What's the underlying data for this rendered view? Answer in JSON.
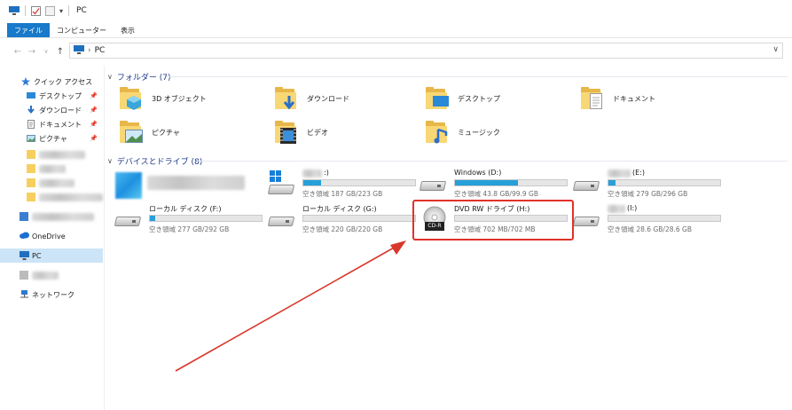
{
  "title": "PC",
  "ribbon": {
    "tabs": [
      "ファイル",
      "コンピューター",
      "表示"
    ]
  },
  "address": {
    "location": "PC"
  },
  "sidebar": {
    "quick_access": "クイック アクセス",
    "items": [
      {
        "label": "デスクトップ",
        "icon": "desktop-icon"
      },
      {
        "label": "ダウンロード",
        "icon": "download-icon"
      },
      {
        "label": "ドキュメント",
        "icon": "document-icon"
      },
      {
        "label": "ピクチャ",
        "icon": "pictures-icon"
      }
    ],
    "onedrive": "OneDrive",
    "pc": "PC",
    "network": "ネットワーク"
  },
  "folders_group": {
    "title": "フォルダー (7)"
  },
  "folders": [
    {
      "label": "3D オブジェクト",
      "icon": "3d-objects-folder-icon"
    },
    {
      "label": "ダウンロード",
      "icon": "downloads-folder-icon"
    },
    {
      "label": "デスクトップ",
      "icon": "desktop-folder-icon"
    },
    {
      "label": "ドキュメント",
      "icon": "documents-folder-icon"
    },
    {
      "label": "ピクチャ",
      "icon": "pictures-folder-icon"
    },
    {
      "label": "ビデオ",
      "icon": "videos-folder-icon"
    },
    {
      "label": "ミュージック",
      "icon": "music-folder-icon"
    }
  ],
  "drives_group": {
    "title": "デバイスとドライブ (8)"
  },
  "drives": [
    {
      "name": "",
      "free": "",
      "used_fraction": 0
    },
    {
      "name": ":)",
      "free": "空き領域 187 GB/223 GB",
      "used_fraction": 0.16
    },
    {
      "name": "Windows (D:)",
      "free": "空き領域 43.8 GB/99.9 GB",
      "used_fraction": 0.56
    },
    {
      "name": "(E:)",
      "free": "空き領域 279 GB/296 GB",
      "used_fraction": 0.06
    },
    {
      "name": "ローカル ディスク (F:)",
      "free": "空き領域 277 GB/292 GB",
      "used_fraction": 0.05
    },
    {
      "name": "ローカル ディスク (G:)",
      "free": "空き領域 220 GB/220 GB",
      "used_fraction": 0.0
    },
    {
      "name": "DVD RW ドライブ (H:)",
      "free": "空き領域 702 MB/702 MB",
      "used_fraction": 0.0,
      "badge": "CD-R"
    },
    {
      "name": "(I:)",
      "free": "空き領域 28.6 GB/28.6 GB",
      "used_fraction": 0.0
    }
  ],
  "colors": {
    "accent": "#1979ca",
    "bar_fill": "#26a0da",
    "highlight": "#e0322a",
    "arrow": "#d9372b"
  }
}
